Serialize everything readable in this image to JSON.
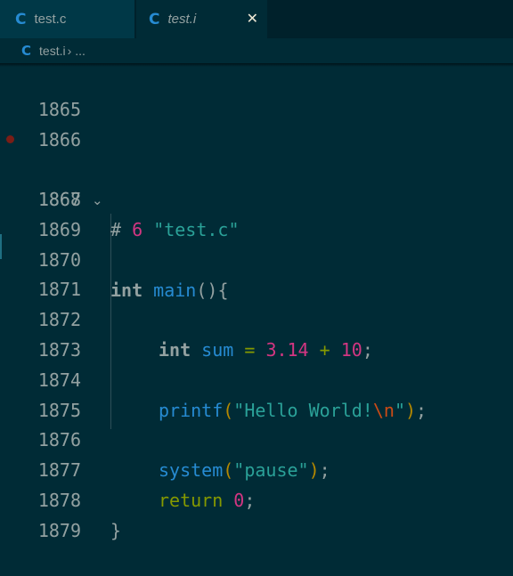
{
  "tabs": [
    {
      "label": "test.c",
      "active": false
    },
    {
      "label": "test.i",
      "active": true
    }
  ],
  "icons": {
    "c_file": "C",
    "close": "✕",
    "chevron": "›",
    "fold": "⌄"
  },
  "breadcrumb": {
    "file": "test.i",
    "rest": "..."
  },
  "line_numbers": [
    "1865",
    "1866",
    "1867",
    "1868",
    "1869",
    "1870",
    "1871",
    "1872",
    "1873",
    "1874",
    "1875",
    "1876",
    "1877",
    "1878",
    "1879"
  ],
  "code": {
    "l1868": {
      "hash": "#",
      "num": "6",
      "str": "\"test.c\""
    },
    "l1869": {
      "kw": "int",
      "fn": "main",
      "paren": "()",
      "brace": "{"
    },
    "l1872": {
      "kw": "int",
      "var": "sum",
      "eq": "=",
      "n1": "3.14",
      "plus": "+",
      "n2": "10",
      "semi": ";"
    },
    "l1874": {
      "fn": "printf",
      "lp": "(",
      "str": "\"Hello World!",
      "esc": "\\n",
      "strend": "\"",
      "rp": ")",
      "semi": ";"
    },
    "l1876": {
      "fn": "system",
      "lp": "(",
      "str": "\"pause\"",
      "rp": ")",
      "semi": ";"
    },
    "l1877": {
      "kw": "return",
      "num": "0",
      "semi": ";"
    },
    "l1878": {
      "brace": "}"
    }
  },
  "colors": {
    "background": "#002b36",
    "tab_inactive": "#003847",
    "keyword": "#93a1a1",
    "function": "#268bd2",
    "number": "#d33682",
    "string": "#2aa198",
    "operator": "#859900",
    "escape": "#cb4b16",
    "bracket": "#b58900",
    "breakpoint": "#7a1d16"
  }
}
